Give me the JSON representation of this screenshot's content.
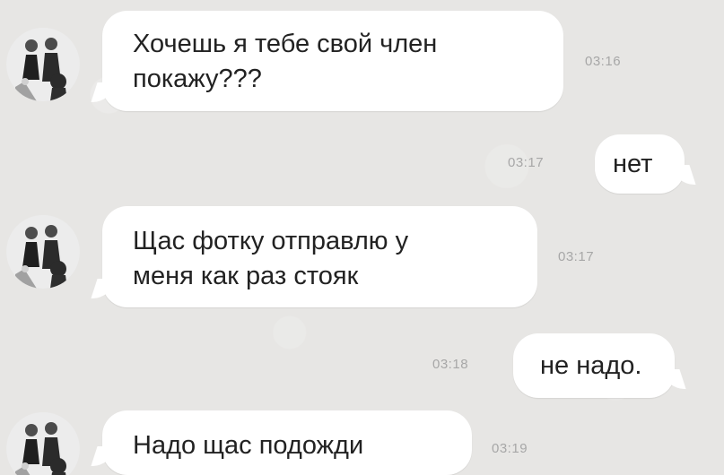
{
  "messages": [
    {
      "direction": "incoming",
      "text_line_1": "Хочешь я тебе свой член",
      "text_line_2": "покажу???",
      "time": "03:16"
    },
    {
      "direction": "outgoing",
      "text": "нет",
      "time": "03:17"
    },
    {
      "direction": "incoming",
      "text_line_1": "Щас фотку отправлю у",
      "text_line_2": "меня как раз стояк",
      "time": "03:17"
    },
    {
      "direction": "outgoing",
      "text": "не надо.",
      "time": "03:18"
    },
    {
      "direction": "incoming",
      "text": "Надо щас подожди",
      "time": "03:19"
    }
  ]
}
